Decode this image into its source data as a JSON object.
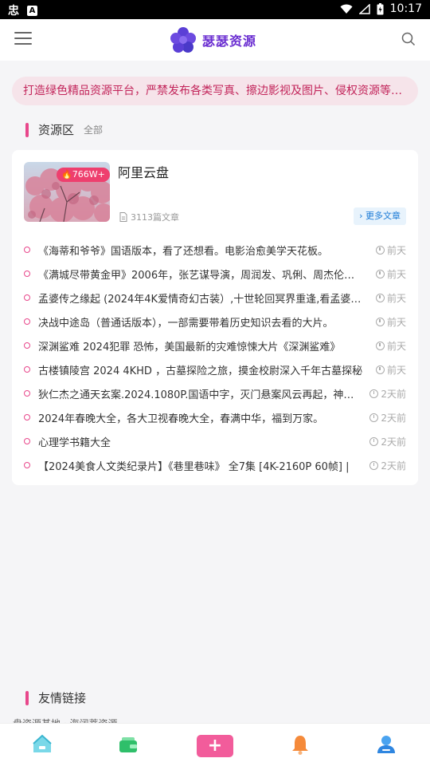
{
  "status_bar": {
    "app_icon_1": "忠",
    "app_icon_2": "A",
    "time": "10:17"
  },
  "header": {
    "logo_text": "瑟瑟资源"
  },
  "notice": {
    "text": "打造绿色精品资源平台，严禁发布各类写真、擦边影视及图片、侵权资源等违…"
  },
  "resource_section": {
    "title": "资源区",
    "filter": "全部"
  },
  "card": {
    "badge": "766W+",
    "title": "阿里云盘",
    "post_count": "3113篇文章",
    "more_label": "更多文章",
    "articles": [
      {
        "title": "《海蒂和爷爷》国语版本，看了还想看。电影治愈美学天花板。",
        "time": "前天"
      },
      {
        "title": "《满城尽带黄金甲》2006年，张艺谋导演，周润发、巩俐、周杰伦主演",
        "time": "前天"
      },
      {
        "title": "孟婆传之缘起 (2024年4K爱情奇幻古装）,十世轮回冥界重逢,看孟婆如何",
        "time": "前天"
      },
      {
        "title": "决战中途岛（普通话版本），一部需要带着历史知识去看的大片。",
        "time": "前天"
      },
      {
        "title": "深渊鲨难 2024犯罪 恐怖，美国最新的灾难惊悚大片《深渊鲨难》",
        "time": "前天"
      },
      {
        "title": "古楼镇陵宫 2024 4KHD ，古墓探险之旅，摸金校尉深入千年古墓探秘",
        "time": "前天"
      },
      {
        "title": "狄仁杰之通天玄案.2024.1080P.国语中字，灭门悬案风云再起，神探狄仁杰",
        "time": "2天前"
      },
      {
        "title": "2024年春晚大全，各大卫视春晚大全，春满中华，福到万家。",
        "time": "2天前"
      },
      {
        "title": "心理学书籍大全",
        "time": "2天前"
      },
      {
        "title": "【2024美食人文类纪录片】《巷里巷味》 全7集 [4K-2160P 60帧] |",
        "time": "2天前"
      }
    ]
  },
  "links_section": {
    "title": "友情链接",
    "links_text": "盘资源基地 · 海阔蒂资源"
  },
  "colors": {
    "accent_pink": "#e8478b",
    "notice_text": "#c2245a",
    "link_blue": "#1a7ad6"
  }
}
